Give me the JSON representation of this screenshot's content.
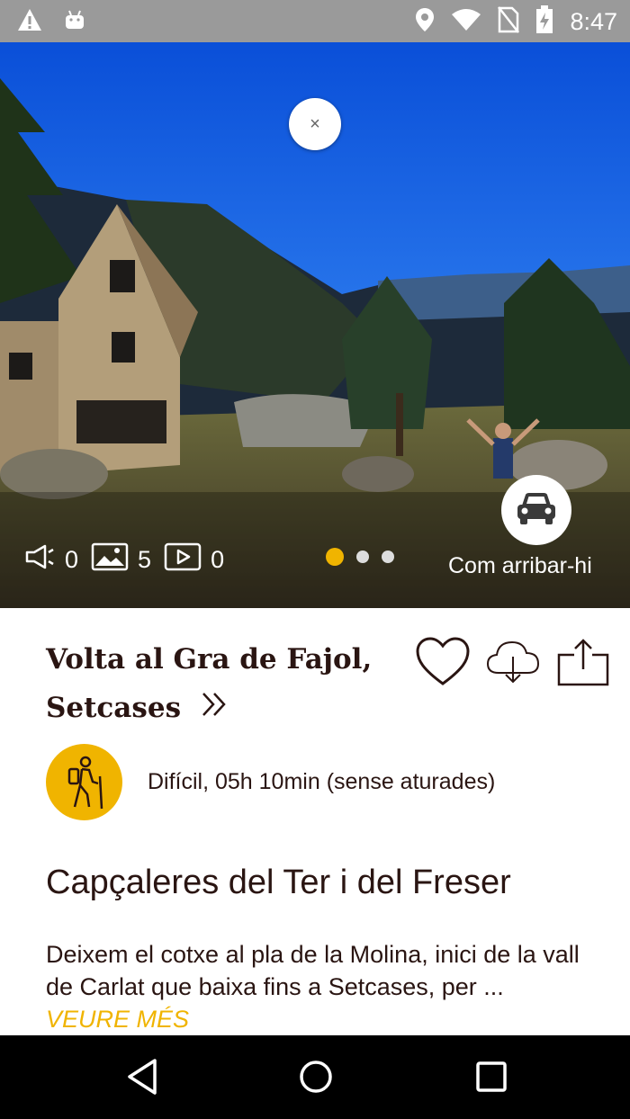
{
  "status_bar": {
    "time": "8:47"
  },
  "hero": {
    "close_label": "×",
    "audio_count": "0",
    "photo_count": "5",
    "video_count": "0",
    "carousel_total": 3,
    "carousel_active": 0,
    "directions_label": "Com arribar-hi"
  },
  "route": {
    "title_line1": "Volta al Gra de Fajol,",
    "title_line2": "Setcases",
    "difficulty_text": "Difícil, 05h 10min (sense aturades)",
    "section_title": "Capçaleres del Ter i del Freser",
    "description": "Deixem el cotxe al pla de la Molina, inici de la vall de Carlat que baixa fins a Setcases, per ...",
    "read_more": "VEURE MÉS"
  },
  "colors": {
    "accent": "#f0b400",
    "text": "#2a1512"
  }
}
